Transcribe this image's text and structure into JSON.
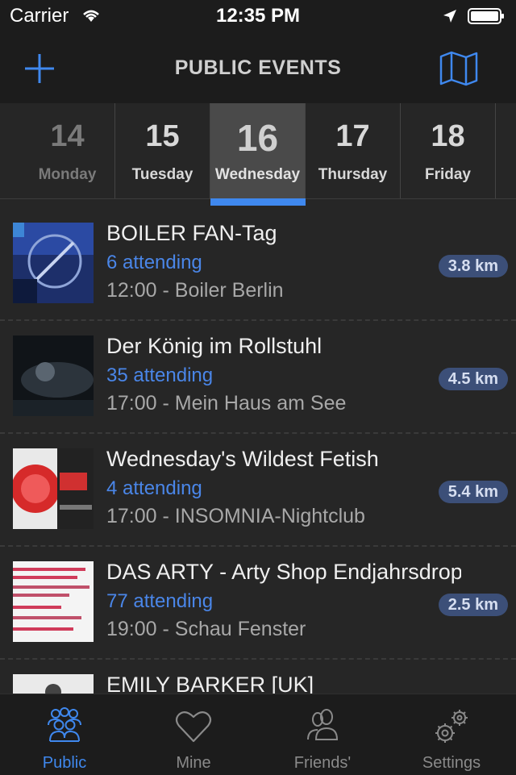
{
  "status_bar": {
    "carrier": "Carrier",
    "time": "12:35 PM"
  },
  "nav": {
    "title": "PUBLIC EVENTS",
    "left_icon": "plus-icon",
    "right_icon": "map-icon"
  },
  "accent_color": "#3f88ee",
  "dates": [
    {
      "num": "14",
      "name": "Monday"
    },
    {
      "num": "15",
      "name": "Tuesday"
    },
    {
      "num": "16",
      "name": "Wednesday"
    },
    {
      "num": "17",
      "name": "Thursday"
    },
    {
      "num": "18",
      "name": "Friday"
    }
  ],
  "events": [
    {
      "title": "BOILER FAN-Tag",
      "attending": "6 attending",
      "meta": "12:00 - Boiler Berlin",
      "distance": "3.8 km"
    },
    {
      "title": "Der König im Rollstuhl",
      "attending": "35 attending",
      "meta": "17:00 - Mein Haus am See",
      "distance": "4.5 km"
    },
    {
      "title": "Wednesday's Wildest Fetish",
      "attending": "4 attending",
      "meta": "17:00 - INSOMNIA-Nightclub",
      "distance": "5.4 km"
    },
    {
      "title": "DAS ARTY - Arty Shop Endjahrsdrop 2...",
      "attending": "77 attending",
      "meta": "19:00 - Schau Fenster",
      "distance": "2.5 km"
    },
    {
      "title": "EMILY BARKER [UK]",
      "attending": "",
      "meta": "",
      "distance": ""
    }
  ],
  "tabs": [
    {
      "label": "Public",
      "icon": "group-icon"
    },
    {
      "label": "Mine",
      "icon": "heart-icon"
    },
    {
      "label": "Friends'",
      "icon": "friends-icon"
    },
    {
      "label": "Settings",
      "icon": "gears-icon"
    }
  ]
}
